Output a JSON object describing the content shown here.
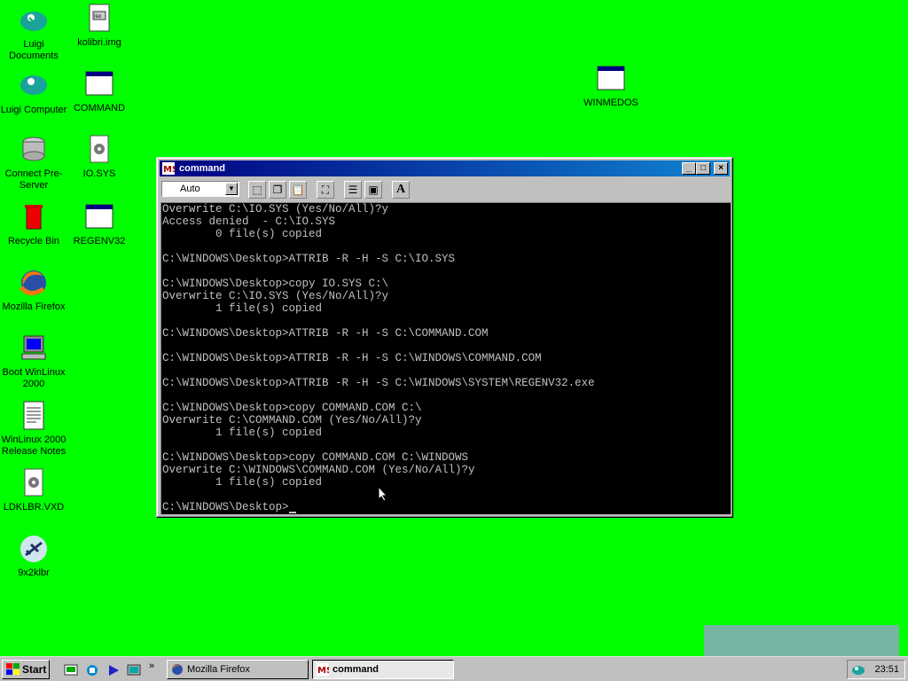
{
  "desktop": {
    "background": "#00ff00",
    "icons": [
      {
        "label": "Luigi Documents",
        "icon": "documents-folder-icon"
      },
      {
        "label": "kolibri.img",
        "icon": "disk-image-icon"
      },
      {
        "label": "Luigi Computer",
        "icon": "computer-icon"
      },
      {
        "label": "COMMAND",
        "icon": "window-app-icon"
      },
      {
        "label": "Connect Pre-Server",
        "icon": "server-icon"
      },
      {
        "label": "IO.SYS",
        "icon": "system-file-icon"
      },
      {
        "label": "Recycle Bin",
        "icon": "recycle-bin-icon"
      },
      {
        "label": "REGENV32",
        "icon": "window-app-icon"
      },
      {
        "label": "Mozilla Firefox",
        "icon": "firefox-icon"
      },
      {
        "label": "Boot WinLinux 2000",
        "icon": "boot-computer-icon"
      },
      {
        "label": "WinLinux 2000 Release Notes",
        "icon": "text-document-icon"
      },
      {
        "label": "LDKLBR.VXD",
        "icon": "system-file-icon"
      },
      {
        "label": "9x2klbr",
        "icon": "plane-icon"
      },
      {
        "label": "WINMEDOS",
        "icon": "window-app-icon"
      }
    ]
  },
  "window": {
    "title": "command",
    "font_select": "Auto",
    "console_lines": [
      "Overwrite C:\\IO.SYS (Yes/No/All)?y",
      "Access denied  - C:\\IO.SYS",
      "        0 file(s) copied",
      "",
      "C:\\WINDOWS\\Desktop>ATTRIB -R -H -S C:\\IO.SYS",
      "",
      "C:\\WINDOWS\\Desktop>copy IO.SYS C:\\",
      "Overwrite C:\\IO.SYS (Yes/No/All)?y",
      "        1 file(s) copied",
      "",
      "C:\\WINDOWS\\Desktop>ATTRIB -R -H -S C:\\COMMAND.COM",
      "",
      "C:\\WINDOWS\\Desktop>ATTRIB -R -H -S C:\\WINDOWS\\COMMAND.COM",
      "",
      "C:\\WINDOWS\\Desktop>ATTRIB -R -H -S C:\\WINDOWS\\SYSTEM\\REGENV32.exe",
      "",
      "C:\\WINDOWS\\Desktop>copy COMMAND.COM C:\\",
      "Overwrite C:\\COMMAND.COM (Yes/No/All)?y",
      "        1 file(s) copied",
      "",
      "C:\\WINDOWS\\Desktop>copy COMMAND.COM C:\\WINDOWS",
      "Overwrite C:\\WINDOWS\\COMMAND.COM (Yes/No/All)?y",
      "        1 file(s) copied",
      "",
      "C:\\WINDOWS\\Desktop>"
    ]
  },
  "taskbar": {
    "start_label": "Start",
    "tasks": [
      {
        "label": "Mozilla Firefox",
        "active": false
      },
      {
        "label": "command",
        "active": true
      }
    ],
    "clock": "23:51"
  }
}
